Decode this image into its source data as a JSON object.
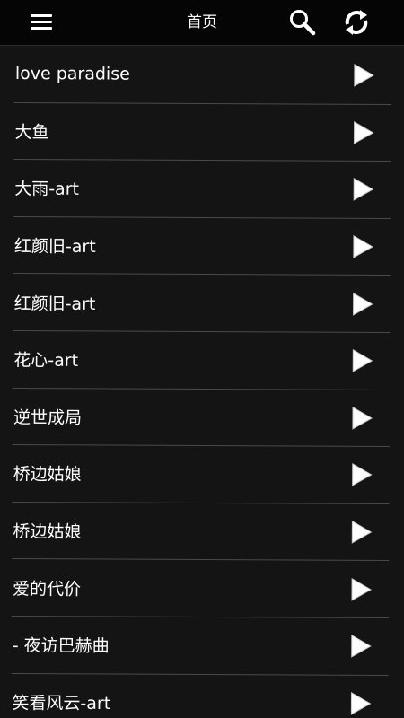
{
  "appbar": {
    "title": "首页",
    "menu_icon": "menu-icon",
    "search_icon": "search-icon",
    "refresh_icon": "refresh-icon"
  },
  "songs": [
    {
      "title": "love paradise"
    },
    {
      "title": "大鱼"
    },
    {
      "title": "大雨-art"
    },
    {
      "title": "红颜旧-art"
    },
    {
      "title": "红颜旧-art"
    },
    {
      "title": "花心-art"
    },
    {
      "title": "逆世成局"
    },
    {
      "title": "桥边姑娘"
    },
    {
      "title": "桥边姑娘"
    },
    {
      "title": "爱的代价"
    },
    {
      "title": "- 夜访巴赫曲"
    },
    {
      "title": "笑看风云-art"
    }
  ],
  "colors": {
    "appbar_bg": "#050505",
    "list_bg": "#141414",
    "divider": "#4a4a4a",
    "text": "#ffffff",
    "play_icon_fill": "#ffffff"
  }
}
